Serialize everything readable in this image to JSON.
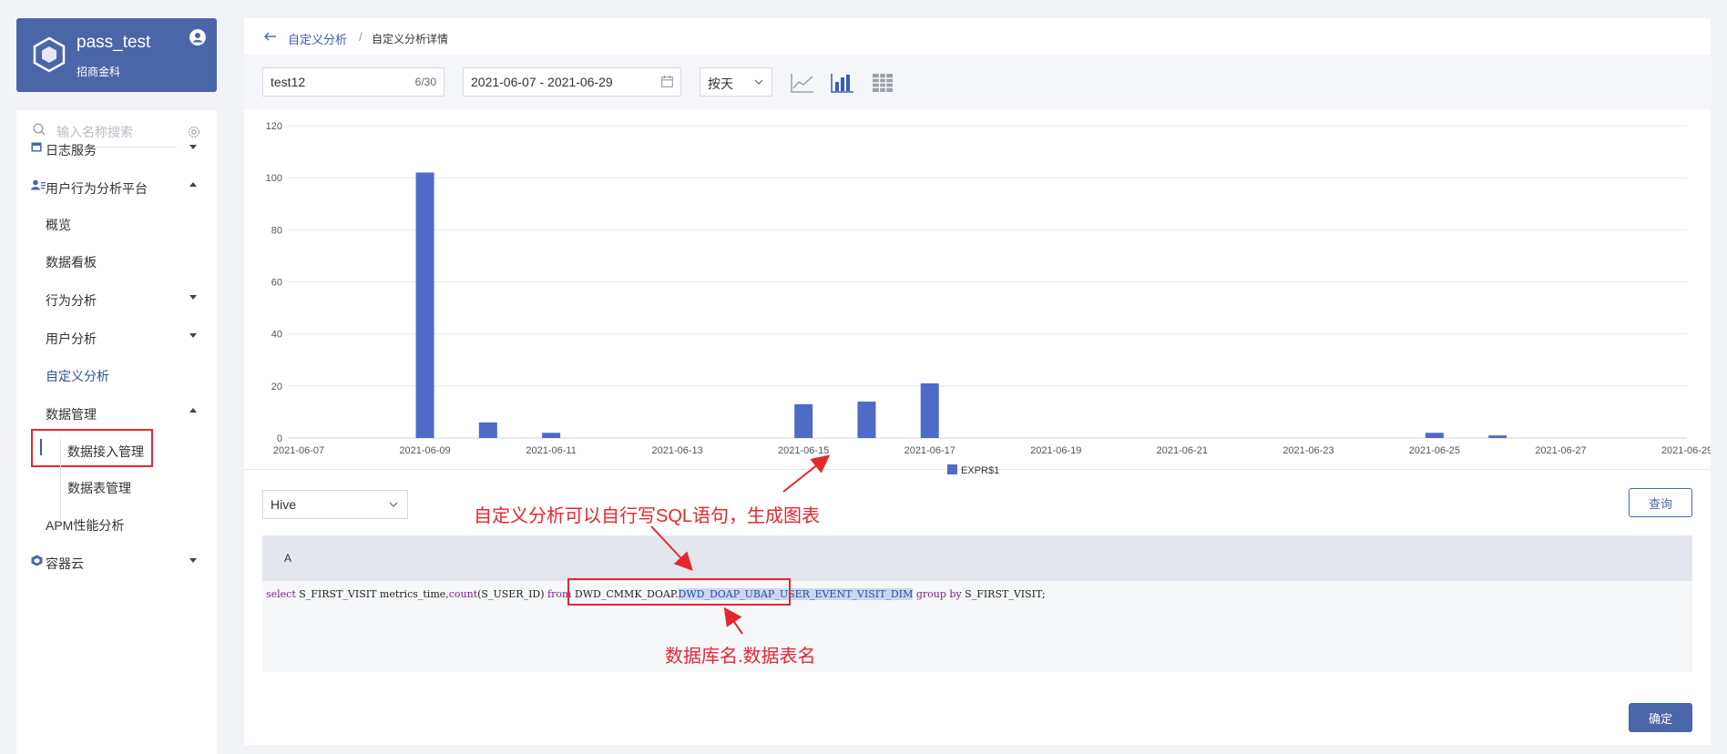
{
  "app": {
    "name": "pass_test",
    "subtitle": "招商金科",
    "user_icon": "user-circle-icon"
  },
  "sidebar": {
    "search_placeholder": "输入名称搜索",
    "items": [
      {
        "label": "日志服务",
        "icon": "calendar-icon",
        "expanded": false
      },
      {
        "label": "用户行为分析平台",
        "icon": "user-group-icon",
        "expanded": true
      },
      {
        "label": "概览"
      },
      {
        "label": "数据看板"
      },
      {
        "label": "行为分析",
        "expanded": false
      },
      {
        "label": "用户分析",
        "expanded": false
      },
      {
        "label": "自定义分析",
        "active": true
      },
      {
        "label": "数据管理",
        "expanded": true
      },
      {
        "label": "数据接入管理"
      },
      {
        "label": "数据表管理"
      },
      {
        "label": "APM性能分析"
      },
      {
        "label": "容器云",
        "icon": "cube-icon",
        "expanded": false
      }
    ]
  },
  "breadcrumb": {
    "parent": "自定义分析",
    "separator": "/",
    "current": "自定义分析详情"
  },
  "toolbar": {
    "name_value": "test12",
    "name_count": "6/30",
    "date_range": "2021-06-07 - 2021-06-29",
    "granularity": "按天",
    "views": [
      "line-chart-icon",
      "bar-chart-icon",
      "table-icon"
    ]
  },
  "chart_data": {
    "type": "bar",
    "title": "",
    "xlabel": "",
    "ylabel": "",
    "ylim": [
      0,
      120
    ],
    "yticks": [
      0,
      20,
      40,
      60,
      80,
      100,
      120
    ],
    "xticks": [
      "2021-06-07",
      "2021-06-09",
      "2021-06-11",
      "2021-06-13",
      "2021-06-15",
      "2021-06-17",
      "2021-06-19",
      "2021-06-21",
      "2021-06-23",
      "2021-06-25",
      "2021-06-27",
      "2021-06-29"
    ],
    "categories": [
      "2021-06-07",
      "2021-06-08",
      "2021-06-09",
      "2021-06-10",
      "2021-06-11",
      "2021-06-12",
      "2021-06-13",
      "2021-06-14",
      "2021-06-15",
      "2021-06-16",
      "2021-06-17",
      "2021-06-18",
      "2021-06-19",
      "2021-06-20",
      "2021-06-21",
      "2021-06-22",
      "2021-06-23",
      "2021-06-24",
      "2021-06-25",
      "2021-06-26",
      "2021-06-27",
      "2021-06-28",
      "2021-06-29"
    ],
    "series": [
      {
        "name": "EXPR$1",
        "color": "#4f6bc8",
        "values": [
          0,
          0,
          102,
          6,
          2,
          0,
          0,
          0,
          13,
          14,
          21,
          0,
          0,
          0,
          0,
          0,
          0,
          0,
          2,
          1,
          0,
          0,
          0
        ]
      }
    ],
    "legend": "bottom-center",
    "grid": true
  },
  "query": {
    "engine": "Hive",
    "query_button": "查询",
    "column_header": "A",
    "sql_parts": {
      "kw_select": "select",
      "p1": " S_FIRST_VISIT metrics_time,",
      "fn_count": "count",
      "p2": "(S_USER_ID) ",
      "kw_from": "from",
      "db": " DWD_CMMK_DOAP.",
      "table": "DWD_DOAP_UBAP_USER_EVENT_VISIT_DIM",
      "p3": " ",
      "kw_group": "group by",
      "p4": " S_FIRST_VISIT;"
    },
    "confirm_button": "确定"
  },
  "annotations": {
    "top_note": "自定义分析可以自行写SQL语句，生成图表",
    "bottom_note": "数据库名.数据表名",
    "color": "#e8262f"
  }
}
